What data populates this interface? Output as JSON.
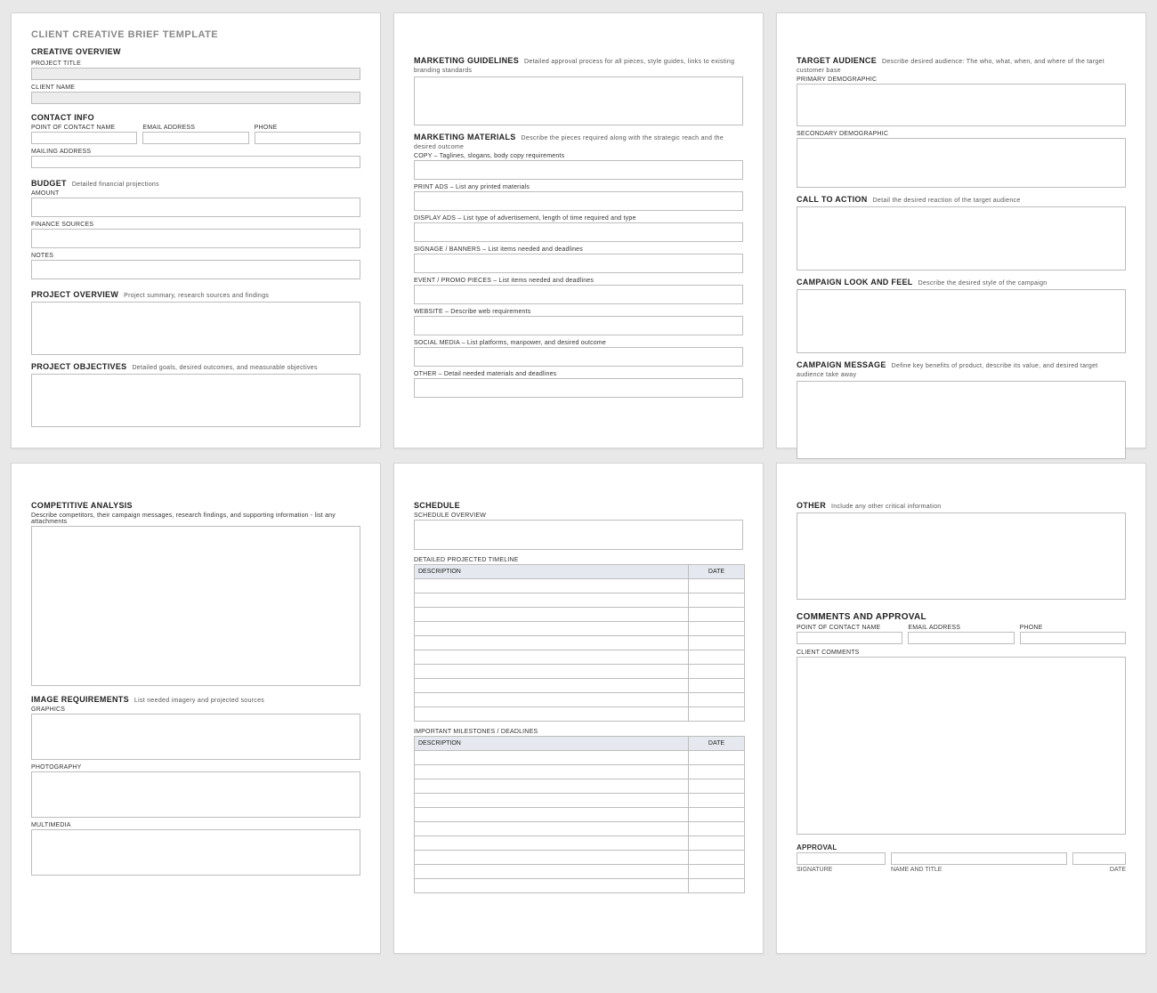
{
  "doc_title": "CLIENT CREATIVE BRIEF TEMPLATE",
  "p1": {
    "creative_overview": "CREATIVE OVERVIEW",
    "project_title": "PROJECT TITLE",
    "client_name": "CLIENT NAME",
    "contact_info": "CONTACT INFO",
    "poc": "POINT OF CONTACT NAME",
    "email": "EMAIL ADDRESS",
    "phone": "PHONE",
    "mailing": "MAILING ADDRESS",
    "budget": "BUDGET",
    "budget_note": "Detailed financial projections",
    "amount": "AMOUNT",
    "finance_sources": "FINANCE SOURCES",
    "notes": "NOTES",
    "proj_overview": "PROJECT OVERVIEW",
    "proj_overview_note": "Project summary, research sources and findings",
    "proj_objectives": "PROJECT OBJECTIVES",
    "proj_objectives_note": "Detailed goals, desired outcomes, and measurable objectives"
  },
  "p2": {
    "mkt_guidelines": "MARKETING GUIDELINES",
    "mkt_guidelines_note": "Detailed approval process for all pieces, style guides, links to existing branding standards",
    "mkt_materials": "MARKETING MATERIALS",
    "mkt_materials_note": "Describe the pieces required along with the strategic reach and the desired outcome",
    "copy": "COPY  – Taglines, slogans, body copy requirements",
    "print": "PRINT ADS  – List any printed materials",
    "display": "DISPLAY ADS  – List type of advertisement, length of time required and type",
    "signage": "SIGNAGE / BANNERS  – List items needed and deadlines",
    "event": "EVENT / PROMO PIECES  – List items needed and deadlines",
    "website": "WEBSITE  – Describe web requirements",
    "social": "SOCIAL MEDIA  – List platforms, manpower, and desired outcome",
    "other": "OTHER  – Detail needed materials and deadlines"
  },
  "p3": {
    "target": "TARGET AUDIENCE",
    "target_note": "Describe desired audience: The who, what, when, and where of the target customer base",
    "primary": "PRIMARY DEMOGRAPHIC",
    "secondary": "SECONDARY DEMOGRAPHIC",
    "cta": "CALL TO ACTION",
    "cta_note": "Detail the desired reaction of the target audience",
    "look": "CAMPAIGN LOOK AND FEEL",
    "look_note": "Describe the desired style of the campaign",
    "msg": "CAMPAIGN MESSAGE",
    "msg_note": "Define key benefits of product, describe its value, and desired target audience take away"
  },
  "p4": {
    "comp": "COMPETITIVE ANALYSIS",
    "comp_note": "Describe competitors, their campaign messages, research findings, and supporting information - list any attachments",
    "img_req": "IMAGE REQUIREMENTS",
    "img_req_note": "List needed imagery and projected sources",
    "graphics": "GRAPHICS",
    "photo": "PHOTOGRAPHY",
    "multi": "MULTIMEDIA"
  },
  "p5": {
    "schedule": "SCHEDULE",
    "overview": "SCHEDULE OVERVIEW",
    "detailed": "DETAILED PROJECTED TIMELINE",
    "desc": "DESCRIPTION",
    "date": "DATE",
    "milestones": "IMPORTANT MILESTONES / DEADLINES"
  },
  "p6": {
    "other": "OTHER",
    "other_note": "Include any other critical information",
    "comments_hdr": "COMMENTS AND APPROVAL",
    "poc": "POINT OF CONTACT NAME",
    "email": "EMAIL ADDRESS",
    "phone": "PHONE",
    "client_comments": "CLIENT COMMENTS",
    "approval": "APPROVAL",
    "signature": "SIGNATURE",
    "name_title": "NAME AND TITLE",
    "date": "DATE"
  }
}
